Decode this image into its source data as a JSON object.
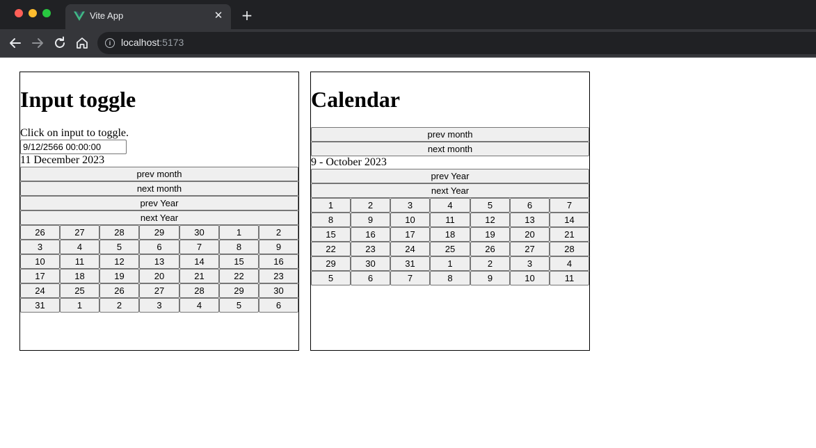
{
  "browser": {
    "tab_title": "Vite App",
    "tab_close": "✕",
    "new_tab": "+",
    "url_host": "localhost",
    "url_port": ":5173"
  },
  "left_panel": {
    "title": "Input toggle",
    "instruction": "Click on input to toggle.",
    "input_value": "9/12/2566 00:00:00",
    "selected_date": "11 December 2023",
    "buttons": {
      "prev_month": "prev month",
      "next_month": "next month",
      "prev_year": "prev Year",
      "next_year": "next Year"
    },
    "days": [
      "26",
      "27",
      "28",
      "29",
      "30",
      "1",
      "2",
      "3",
      "4",
      "5",
      "6",
      "7",
      "8",
      "9",
      "10",
      "11",
      "12",
      "13",
      "14",
      "15",
      "16",
      "17",
      "18",
      "19",
      "20",
      "21",
      "22",
      "23",
      "24",
      "25",
      "26",
      "27",
      "28",
      "29",
      "30",
      "31",
      "1",
      "2",
      "3",
      "4",
      "5",
      "6"
    ]
  },
  "right_panel": {
    "title": "Calendar",
    "buttons": {
      "prev_month": "prev month",
      "next_month": "next month",
      "prev_year": "prev Year",
      "next_year": "next Year"
    },
    "month_label": "9 - October 2023",
    "days": [
      "1",
      "2",
      "3",
      "4",
      "5",
      "6",
      "7",
      "8",
      "9",
      "10",
      "11",
      "12",
      "13",
      "14",
      "15",
      "16",
      "17",
      "18",
      "19",
      "20",
      "21",
      "22",
      "23",
      "24",
      "25",
      "26",
      "27",
      "28",
      "29",
      "30",
      "31",
      "1",
      "2",
      "3",
      "4",
      "5",
      "6",
      "7",
      "8",
      "9",
      "10",
      "11"
    ]
  }
}
